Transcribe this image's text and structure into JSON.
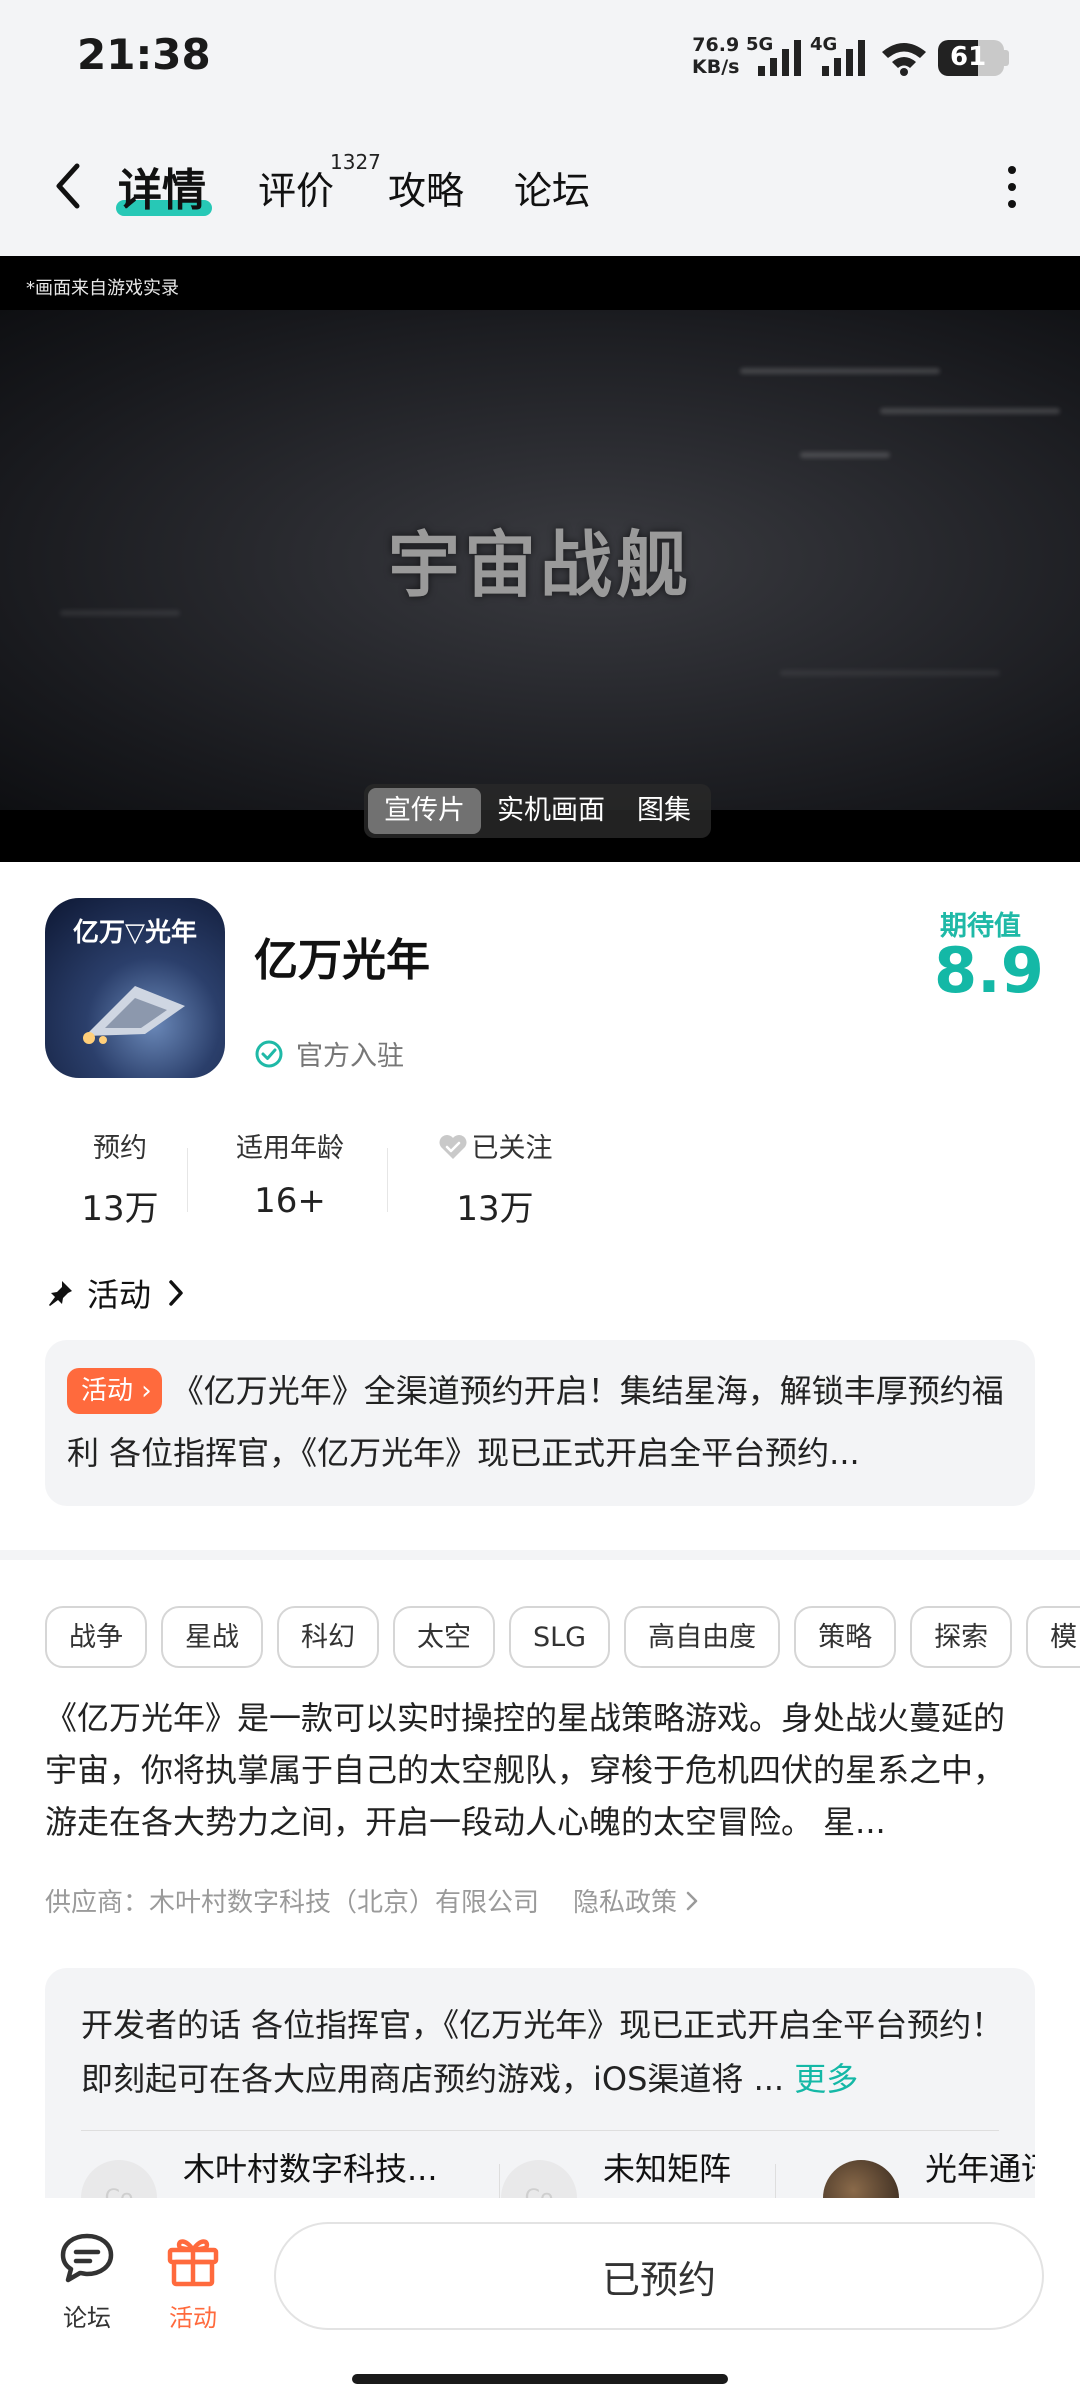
{
  "status_bar": {
    "time": "21:38",
    "net_speed_value": "76.9",
    "net_speed_unit": "KB/s",
    "sim1_label": "5G",
    "sim2_label": "4G",
    "battery": "61",
    "battery_level": 0.61
  },
  "header": {
    "tabs": [
      {
        "label": "详情",
        "active": true
      },
      {
        "label": "评价",
        "active": false
      },
      {
        "label": "攻略",
        "active": false
      },
      {
        "label": "论坛",
        "active": false
      }
    ],
    "review_count": "1327"
  },
  "video": {
    "caption": "*画面来自游戏实录",
    "title": "宇宙战舰",
    "media_tabs": [
      {
        "label": "宣传片",
        "active": true
      },
      {
        "label": "实机画面",
        "active": false
      },
      {
        "label": "图集",
        "active": false
      }
    ]
  },
  "app": {
    "icon_text": "亿万▽光年",
    "name": "亿万光年",
    "official": "官方入驻",
    "expect_label": "期待值",
    "expect_value": "8.9",
    "stats": [
      {
        "label": "预约",
        "value": "13万"
      },
      {
        "label": "适用年龄",
        "value": "16+"
      },
      {
        "label": "已关注",
        "value": "13万"
      }
    ]
  },
  "activity": {
    "heading": "活动",
    "badge": "活动",
    "text": "《亿万光年》全渠道预约开启！集结星海，解锁丰厚预约福利 各位指挥官，《亿万光年》现已正式开启全平台预约..."
  },
  "info": {
    "tags": [
      "战争",
      "星战",
      "科幻",
      "太空",
      "SLG",
      "高自由度",
      "策略",
      "探索",
      "模"
    ],
    "description": "《亿万光年》是一款可以实时操控的星战策略游戏。身处战火蔓延的宇宙，你将执掌属于自己的太空舰队，穿梭于危机四伏的星系之中，游走在各大势力之间，开启一段动人心魄的太空冒险。 星...",
    "supplier": "供应商：木叶村数字科技（北京）有限公司",
    "privacy": "隐私政策"
  },
  "developer": {
    "text": "开发者的话  各位指挥官，《亿万光年》现已正式开启全平台预约！即刻起可在各大应用商店预约游戏，iOS渠道将 ...",
    "more": "更多",
    "authors": [
      {
        "name": "木叶村数字科技..."
      },
      {
        "name": "未知矩阵"
      },
      {
        "name": "光年通讯"
      }
    ]
  },
  "bottom_bar": {
    "forum_label": "论坛",
    "activity_label": "活动",
    "reserve_button": "已预约",
    "accent_color": "#ff6a3d"
  }
}
